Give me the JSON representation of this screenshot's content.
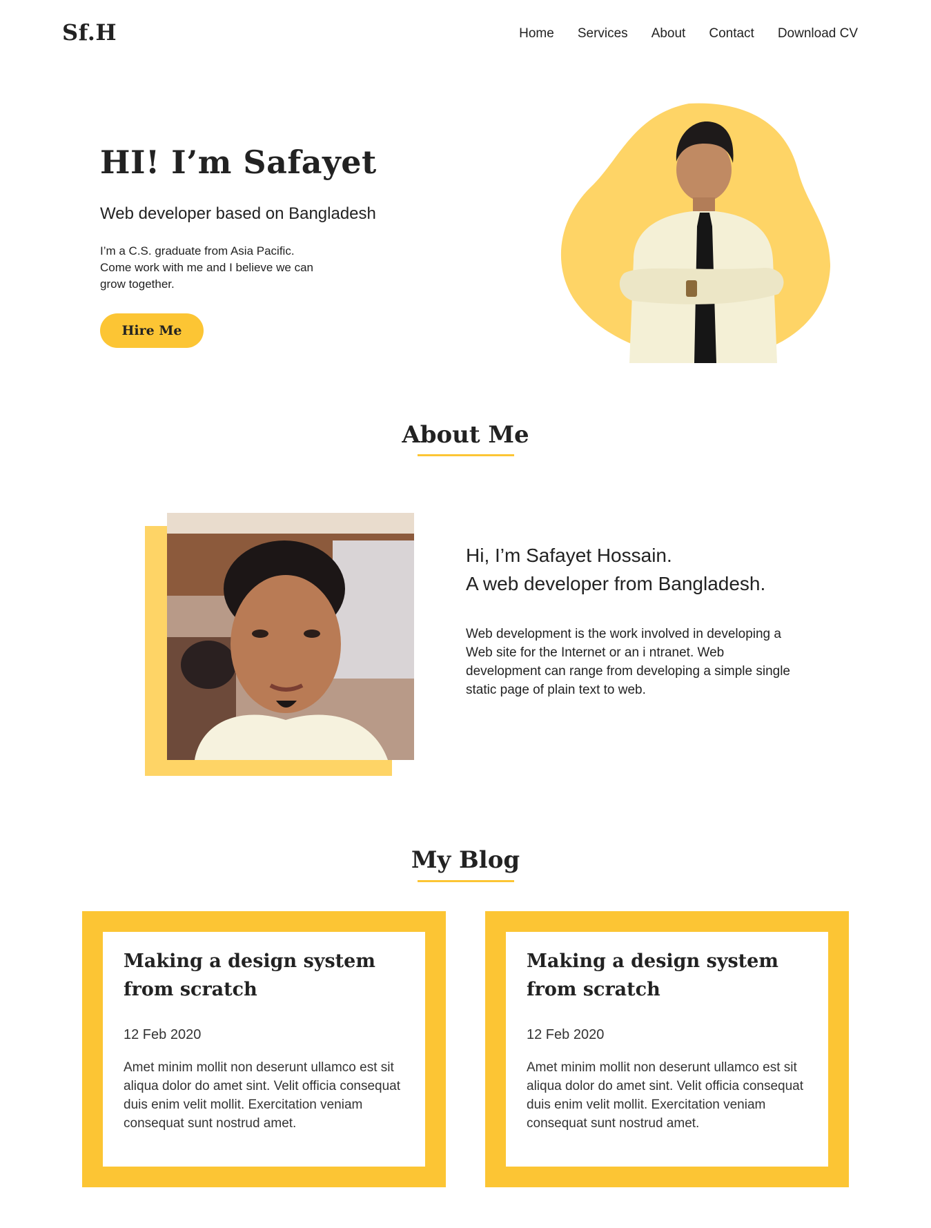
{
  "header": {
    "logo": "Sf.H",
    "nav": [
      "Home",
      "Services",
      "About",
      "Contact",
      "Download CV"
    ]
  },
  "hero": {
    "title": "HI! I’m Safayet",
    "subtitle": "Web developer based on Bangladesh",
    "description": "I’m a C.S. graduate from Asia Pacific. Come work with me and I believe we can grow together.",
    "cta_label": "Hire Me"
  },
  "about": {
    "heading": "About Me",
    "greeting_line1": "Hi, I’m Safayet Hossain.",
    "greeting_line2": "A web developer from Bangladesh.",
    "text": "Web development is the work involved in developing a Web site for the Internet or an i ntranet. Web development can range from developing a simple single static page of plain text to web."
  },
  "blog": {
    "heading": "My Blog",
    "posts": [
      {
        "title": "Making a design system from scratch",
        "date": "12 Feb 2020",
        "excerpt": "Amet minim mollit non deserunt ullamco est sit aliqua dolor do amet sint. Velit officia consequat duis enim velit mollit. Exercitation veniam consequat sunt nostrud amet."
      },
      {
        "title": "Making a design system from scratch",
        "date": "12 Feb 2020",
        "excerpt": "Amet minim mollit non deserunt ullamco est sit aliqua dolor do amet sint. Velit officia consequat duis enim velit mollit. Exercitation veniam consequat sunt nostrud amet."
      }
    ]
  },
  "colors": {
    "accent": "#fcc534",
    "accent_light": "#fed466",
    "text": "#222222"
  }
}
